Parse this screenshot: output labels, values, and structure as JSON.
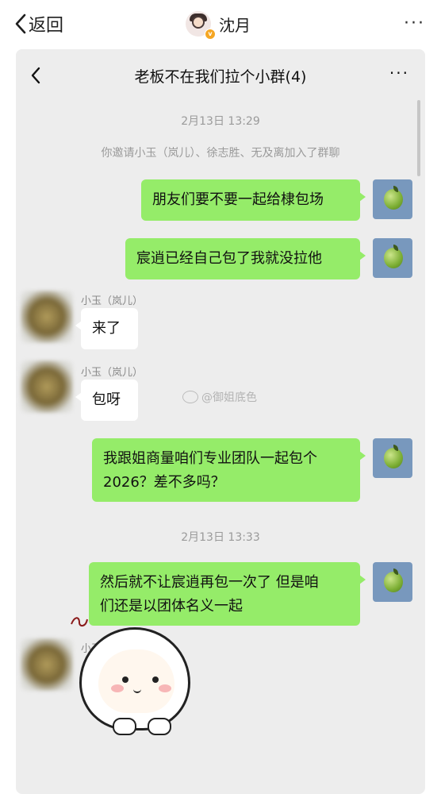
{
  "topbar": {
    "back_label": "返回",
    "contact_name": "沈月",
    "more_label": "···"
  },
  "chat": {
    "title": "老板不在我们拉个小群(4)",
    "more_label": "···",
    "timestamps": [
      "2月13日 13:29",
      "2月13日 13:33"
    ],
    "system_msg": "你邀请小玉（岚儿）、徐志胜、无及离加入了群聊",
    "messages": [
      {
        "sender": "me",
        "text": "朋友们要不要一起给棣包场"
      },
      {
        "sender": "me",
        "text": "宸逍已经自己包了我就没拉他"
      },
      {
        "sender": "other",
        "name": "小玉（岚儿）",
        "text": "来了"
      },
      {
        "sender": "other",
        "name": "小玉（岚儿）",
        "text": "包呀"
      },
      {
        "sender": "me",
        "text_line1": "我跟姐商量咱们专业团队一起包个",
        "text_line2": "2026？差不多吗？"
      },
      {
        "sender": "me",
        "text_line1": "然后就不让宸逍再包一次了 但是咱",
        "text_line2": "们还是以团体名义一起"
      },
      {
        "sender": "other",
        "name": "小玉（岚儿）",
        "sticker": "sheep-sticker"
      }
    ]
  },
  "watermark": {
    "text": "@御姐底色"
  },
  "colors": {
    "my_bubble": "#95ec69",
    "other_bubble": "#ffffff",
    "chat_bg": "#ededed"
  },
  "icons": [
    "chevron-left-icon",
    "more-icon",
    "apple-avatar-icon",
    "sheep-sticker"
  ]
}
